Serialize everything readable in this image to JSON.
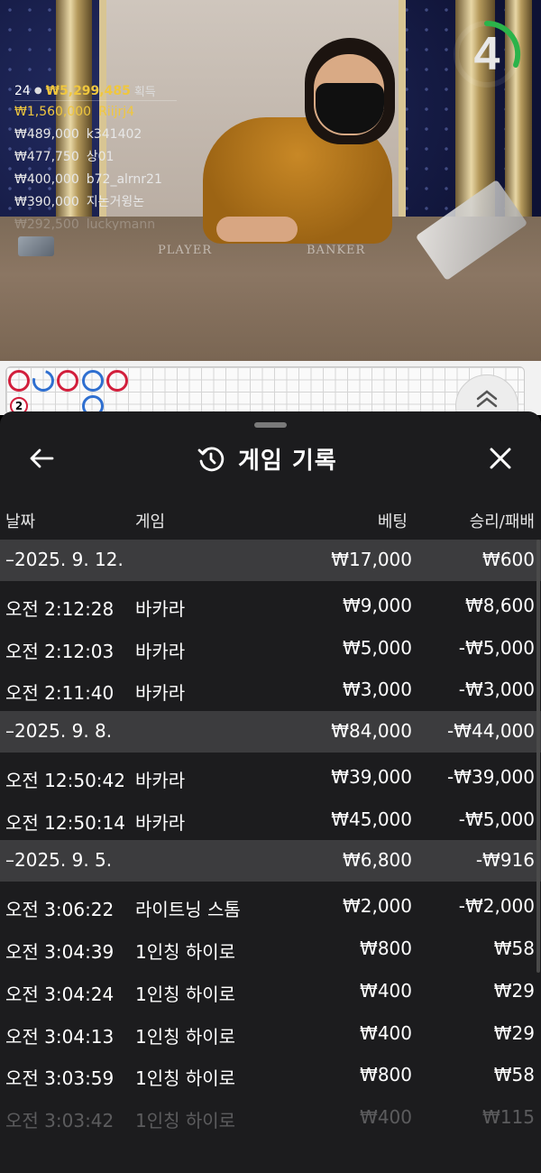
{
  "stream": {
    "timer": "4",
    "table_labels": {
      "player": "PLAYER",
      "banker": "BANKER"
    }
  },
  "winners": {
    "count": "24",
    "total": "₩5,299,485",
    "suffix": "획득",
    "rows": [
      {
        "amount": "₩1,560,000",
        "user": "Riijrj4"
      },
      {
        "amount": "₩489,000",
        "user": "k341402"
      },
      {
        "amount": "₩477,750",
        "user": "상01"
      },
      {
        "amount": "₩400,000",
        "user": "b72_alrnr21"
      },
      {
        "amount": "₩390,000",
        "user": "지논거윙논"
      },
      {
        "amount": "₩292,500",
        "user": "luckymann"
      }
    ]
  },
  "road": {
    "badge_number": "2"
  },
  "sheet": {
    "title": "게임 기록",
    "columns": {
      "date": "날짜",
      "game": "게임",
      "bet": "베팅",
      "win_loss": "승리/패배"
    },
    "groups": [
      {
        "date": "–2025. 9. 12.",
        "bet": "₩17,000",
        "win_loss": "₩600",
        "rows": [
          {
            "time": "오전 2:12:28",
            "game": "바카라",
            "bet": "₩9,000",
            "win_loss": "₩8,600"
          },
          {
            "time": "오전 2:12:03",
            "game": "바카라",
            "bet": "₩5,000",
            "win_loss": "-₩5,000"
          },
          {
            "time": "오전 2:11:40",
            "game": "바카라",
            "bet": "₩3,000",
            "win_loss": "-₩3,000"
          }
        ]
      },
      {
        "date": "–2025. 9. 8.",
        "bet": "₩84,000",
        "win_loss": "-₩44,000",
        "rows": [
          {
            "time": "오전 12:50:42",
            "game": "바카라",
            "bet": "₩39,000",
            "win_loss": "-₩39,000"
          },
          {
            "time": "오전 12:50:14",
            "game": "바카라",
            "bet": "₩45,000",
            "win_loss": "-₩5,000"
          }
        ]
      },
      {
        "date": "–2025. 9. 5.",
        "bet": "₩6,800",
        "win_loss": "-₩916",
        "rows": [
          {
            "time": "오전 3:06:22",
            "game": "라이트닝 스톰",
            "bet": "₩2,000",
            "win_loss": "-₩2,000"
          },
          {
            "time": "오전 3:04:39",
            "game": "1인칭 하이로",
            "bet": "₩800",
            "win_loss": "₩58"
          },
          {
            "time": "오전 3:04:24",
            "game": "1인칭 하이로",
            "bet": "₩400",
            "win_loss": "₩29"
          },
          {
            "time": "오전 3:04:13",
            "game": "1인칭 하이로",
            "bet": "₩400",
            "win_loss": "₩29"
          },
          {
            "time": "오전 3:03:59",
            "game": "1인칭 하이로",
            "bet": "₩800",
            "win_loss": "₩58"
          },
          {
            "time": "오전 3:03:42",
            "game": "1인칭 하이로",
            "bet": "₩400",
            "win_loss": "₩115"
          }
        ]
      }
    ]
  },
  "colors": {
    "gold": "#f0c73e",
    "timer_ring": "#2bb34a",
    "banker_red": "#d21f3c",
    "player_blue": "#2f6fd0",
    "sheet_bg": "#1c1c1e",
    "group_bg": "#3c3c3e"
  },
  "icons": {
    "back": "arrow-left-icon",
    "history": "history-clock-icon",
    "close": "close-icon",
    "scroll": "chevron-double-up-icon",
    "winner": "person-icon"
  }
}
